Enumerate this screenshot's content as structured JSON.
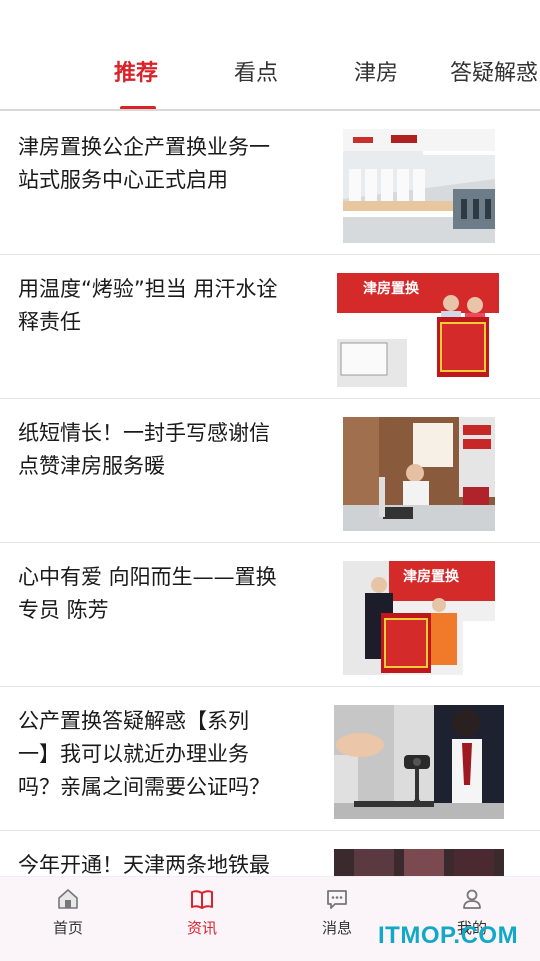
{
  "tabs": [
    {
      "label": "推荐",
      "active": true
    },
    {
      "label": "看点",
      "active": false
    },
    {
      "label": "津房",
      "active": false
    },
    {
      "label": "答疑解惑",
      "active": false
    }
  ],
  "articles": [
    {
      "title_lines": [
        "津房置换公企产置换业务一",
        "站式服务中心正式启用"
      ],
      "image": "service-hall-photo"
    },
    {
      "title_lines": [
        "用温度“烤验”担当 用汗水诠",
        "释责任"
      ],
      "image": "banner-award-photo",
      "image_text": "津房置换"
    },
    {
      "title_lines": [
        "纸短情长！一封手写感谢信",
        "点赞津房服务暖"
      ],
      "image": "service-desk-photo"
    },
    {
      "title_lines": [
        "心中有爱 向阳而生——置换",
        "专员 陈芳"
      ],
      "image": "banner-award-photo-2",
      "image_text": "津房置换"
    },
    {
      "title_lines": [
        "公产置换答疑解惑【系列",
        "一】我可以就近办理业务",
        "吗？亲属之间需要公证吗？"
      ],
      "image": "camera-presenter-photo"
    },
    {
      "title_lines": [
        "今年开通！天津两条地铁最"
      ],
      "image": "people-photo"
    }
  ],
  "bottom_nav": [
    {
      "label": "首页",
      "icon": "home-icon",
      "active": false
    },
    {
      "label": "资讯",
      "icon": "book-icon",
      "active": true
    },
    {
      "label": "消息",
      "icon": "message-icon",
      "active": false
    },
    {
      "label": "我的",
      "icon": "user-icon",
      "active": false
    }
  ],
  "watermark": "ITMOP.COM",
  "colors": {
    "accent": "#d8232a",
    "nav_bg": "#fbf5fa",
    "divider": "#e6e6e6"
  }
}
